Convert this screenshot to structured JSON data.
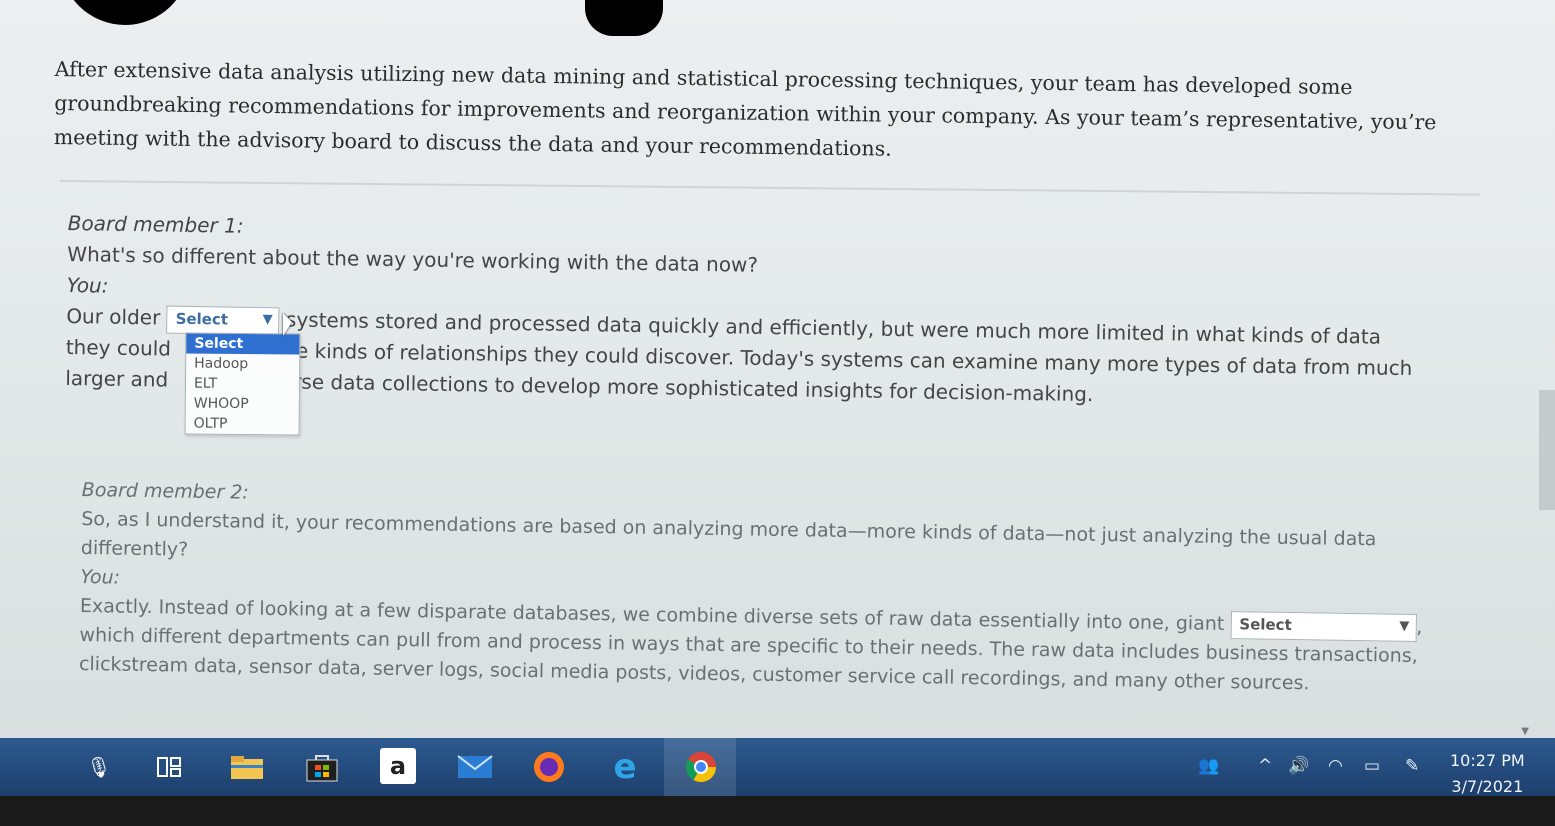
{
  "intro": {
    "text": "After extensive data analysis utilizing new data mining and statistical processing techniques, your team has developed some groundbreaking recommendations for improvements and reorganization within your company. As your team’s representative, you’re meeting with the advisory board to discuss the data and your recommendations."
  },
  "dialogue1": {
    "speaker": "Board member 1:",
    "question": "What's so different about the way you're working with the data now?",
    "you_label": "You:",
    "answer_before": "Our older",
    "select_value": "Select",
    "answer_line1_after": "systems stored and processed data quickly and efficiently, but were much more limited in what kinds of data",
    "answer_line2_start": "they could",
    "answer_line2_end": "e kinds of relationships they could discover. Today's systems can examine many more types of data from much",
    "answer_line3_start": "larger and",
    "answer_line3_end": "rse data collections to develop more sophisticated insights for decision-making.",
    "dropdown_options": [
      "Select",
      "Hadoop",
      "ELT",
      "WHOOP",
      "OLTP"
    ]
  },
  "dialogue2": {
    "speaker": "Board member 2:",
    "question": "So, as I understand it, your recommendations are based on analyzing more data—more kinds of data—not just analyzing the usual data differently?",
    "you_label": "You:",
    "answer_before": "Exactly. Instead of looking at a few disparate databases, we combine diverse sets of raw data essentially into one, giant",
    "select_value": "Select",
    "answer_after": ", which different departments can pull from and process in ways that are specific to their needs. The raw data includes business transactions, clickstream data, sensor data, server logs, social media posts, videos, customer service call recordings, and many other sources."
  },
  "taskbar": {
    "icons": [
      "microphone-icon",
      "task-view-icon",
      "file-explorer-icon",
      "store-icon",
      "amazon-icon",
      "mail-icon",
      "firefox-icon",
      "edge-icon",
      "chrome-icon"
    ],
    "amazon_glyph": "a",
    "time": "10:27 PM",
    "date": "3/7/2021"
  },
  "colors": {
    "taskbar": "#2d5a8f",
    "select_text": "#3b6ea5",
    "highlight": "#2f6fd0"
  }
}
